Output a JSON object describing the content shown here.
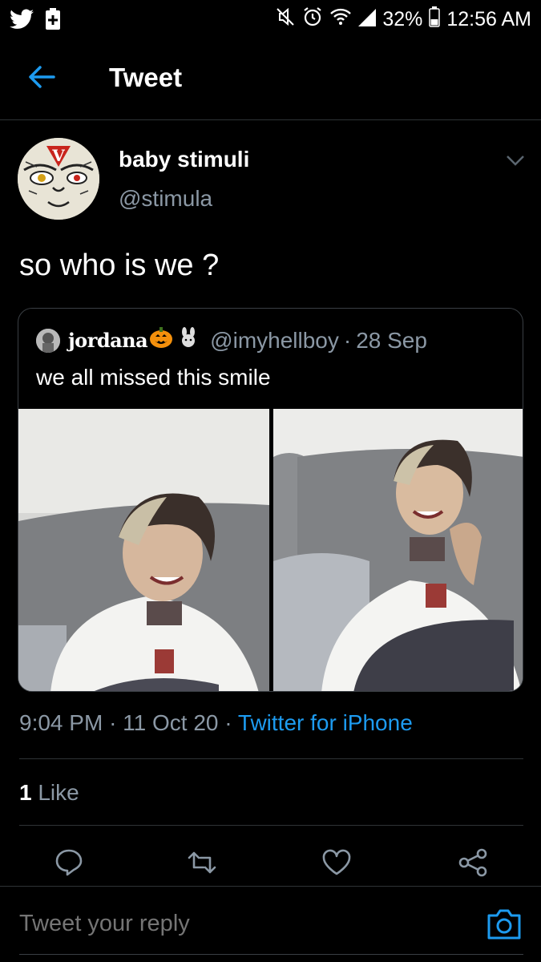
{
  "status_bar": {
    "battery": "32%",
    "time": "12:56 AM"
  },
  "header": {
    "title": "Tweet"
  },
  "tweet": {
    "author_name": "baby stimuli",
    "author_handle": "@stimula",
    "text": "so who is we ?",
    "time": "9:04 PM",
    "date": "11 Oct 20",
    "source": "Twitter for iPhone",
    "likes_count": "1",
    "likes_label": "Like"
  },
  "quote": {
    "author_name": "jordana",
    "author_handle": "@imyhellboy",
    "separator": "·",
    "date": "28 Sep",
    "text": "we all missed this smile"
  },
  "reply": {
    "placeholder": "Tweet your reply"
  },
  "colors": {
    "accent": "#1d9bf0",
    "secondary_text": "#8b98a5",
    "divider": "#2f3336"
  },
  "icons": [
    "twitter-bird-icon",
    "plus-icon",
    "mute-icon",
    "alarm-icon",
    "wifi-icon",
    "signal-icon",
    "battery-icon",
    "back-arrow-icon",
    "chevron-down-icon",
    "reply-icon",
    "retweet-icon",
    "like-icon",
    "share-icon",
    "camera-icon"
  ]
}
